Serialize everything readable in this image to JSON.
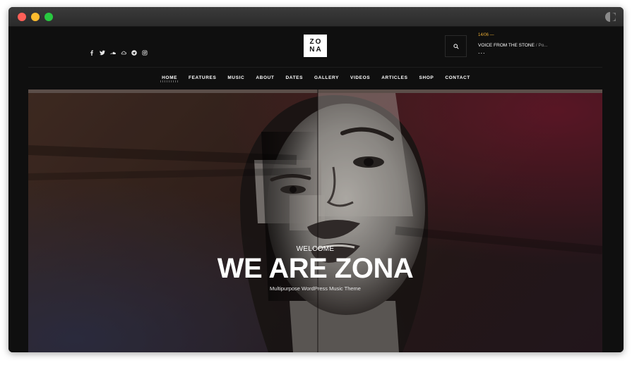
{
  "site": {
    "logo": {
      "line1": "ZO",
      "line2": "NA"
    },
    "social_icons": [
      "facebook-icon",
      "twitter-icon",
      "soundcloud-icon",
      "cloud-icon",
      "telegram-icon",
      "instagram-icon"
    ],
    "news": {
      "date": "14/06 —",
      "title": "VOICE FROM THE STONE",
      "subtitle": "/ Po...",
      "more": "..."
    },
    "nav": [
      {
        "label": "HOME",
        "active": true
      },
      {
        "label": "FEATURES"
      },
      {
        "label": "MUSIC"
      },
      {
        "label": "ABOUT"
      },
      {
        "label": "DATES"
      },
      {
        "label": "GALLERY"
      },
      {
        "label": "VIDEOS"
      },
      {
        "label": "ARTICLES"
      },
      {
        "label": "SHOP"
      },
      {
        "label": "CONTACT"
      }
    ],
    "hero": {
      "eyebrow": "WELCOME",
      "title": "WE ARE ZONA",
      "subtitle": "Multipurpose WordPress Music Theme"
    }
  },
  "colors": {
    "accent": "#e3a733",
    "background": "#0f0f0f",
    "hero_red": "#781c30"
  }
}
